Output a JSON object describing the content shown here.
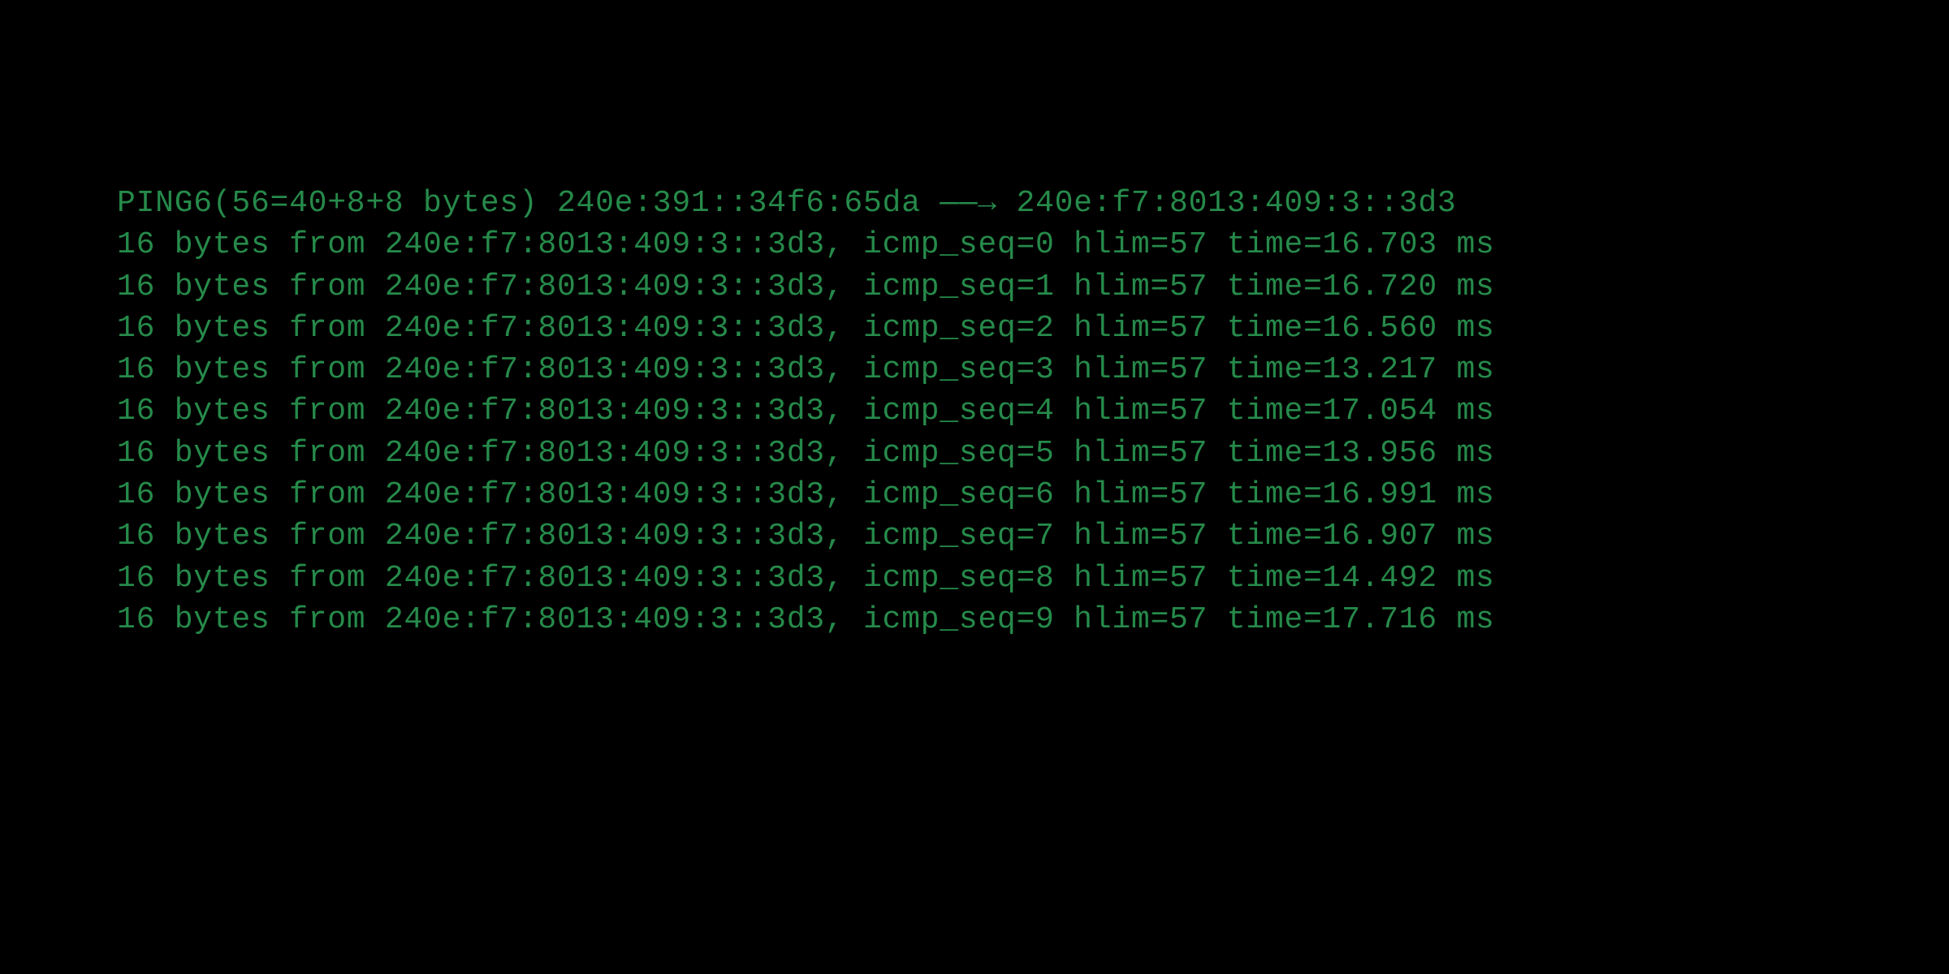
{
  "terminal": {
    "header": "PING6(56=40+8+8 bytes) 240e:391::34f6:65da ——→ 240e:f7:8013:409:3::3d3",
    "replies": [
      "16 bytes from 240e:f7:8013:409:3::3d3, icmp_seq=0 hlim=57 time=16.703 ms",
      "16 bytes from 240e:f7:8013:409:3::3d3, icmp_seq=1 hlim=57 time=16.720 ms",
      "16 bytes from 240e:f7:8013:409:3::3d3, icmp_seq=2 hlim=57 time=16.560 ms",
      "16 bytes from 240e:f7:8013:409:3::3d3, icmp_seq=3 hlim=57 time=13.217 ms",
      "16 bytes from 240e:f7:8013:409:3::3d3, icmp_seq=4 hlim=57 time=17.054 ms",
      "16 bytes from 240e:f7:8013:409:3::3d3, icmp_seq=5 hlim=57 time=13.956 ms",
      "16 bytes from 240e:f7:8013:409:3::3d3, icmp_seq=6 hlim=57 time=16.991 ms",
      "16 bytes from 240e:f7:8013:409:3::3d3, icmp_seq=7 hlim=57 time=16.907 ms",
      "16 bytes from 240e:f7:8013:409:3::3d3, icmp_seq=8 hlim=57 time=14.492 ms",
      "16 bytes from 240e:f7:8013:409:3::3d3, icmp_seq=9 hlim=57 time=17.716 ms"
    ]
  }
}
